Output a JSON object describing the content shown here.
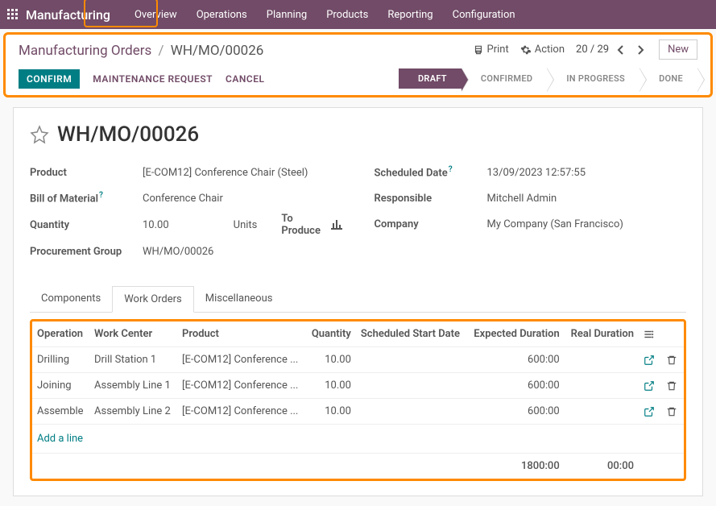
{
  "topnav": {
    "app": "Manufacturing",
    "items": [
      "Overview",
      "Operations",
      "Planning",
      "Products",
      "Reporting",
      "Configuration"
    ]
  },
  "breadcrumb": {
    "root": "Manufacturing Orders",
    "current": "WH/MO/00026"
  },
  "header": {
    "print": "Print",
    "action": "Action",
    "pager": "20 / 29",
    "new": "New",
    "confirm": "CONFIRM",
    "maintenance": "MAINTENANCE REQUEST",
    "cancel": "CANCEL"
  },
  "status": {
    "draft": "DRAFT",
    "confirmed": "CONFIRMED",
    "inprogress": "IN PROGRESS",
    "done": "DONE"
  },
  "record": {
    "title": "WH/MO/00026",
    "product_label": "Product",
    "product_val": "[E-COM12] Conference Chair (Steel)",
    "bom_label": "Bill of Material",
    "bom_val": "Conference Chair",
    "qty_label": "Quantity",
    "qty_val": "10.00",
    "qty_unit": "Units",
    "to_produce": "To Produce",
    "pg_label": "Procurement Group",
    "pg_val": "WH/MO/00026",
    "sched_label": "Scheduled Date",
    "sched_val": "13/09/2023 12:57:55",
    "resp_label": "Responsible",
    "resp_val": "Mitchell Admin",
    "comp_label": "Company",
    "comp_val": "My Company (San Francisco)"
  },
  "tabs": {
    "components": "Components",
    "workorders": "Work Orders",
    "misc": "Miscellaneous"
  },
  "table": {
    "cols": {
      "operation": "Operation",
      "wc": "Work Center",
      "product": "Product",
      "qty": "Quantity",
      "start": "Scheduled Start Date",
      "exp": "Expected Duration",
      "real": "Real Duration"
    },
    "rows": [
      {
        "op": "Drilling",
        "wc": "Drill Station 1",
        "product": "[E-COM12] Conference ...",
        "qty": "10.00",
        "exp": "600:00"
      },
      {
        "op": "Joining",
        "wc": "Assembly Line 1",
        "product": "[E-COM12] Conference ...",
        "qty": "10.00",
        "exp": "600:00"
      },
      {
        "op": "Assemble",
        "wc": "Assembly Line 2",
        "product": "[E-COM12] Conference ...",
        "qty": "10.00",
        "exp": "600:00"
      }
    ],
    "add_line": "Add a line",
    "total_exp": "1800:00",
    "total_real": "00:00"
  }
}
